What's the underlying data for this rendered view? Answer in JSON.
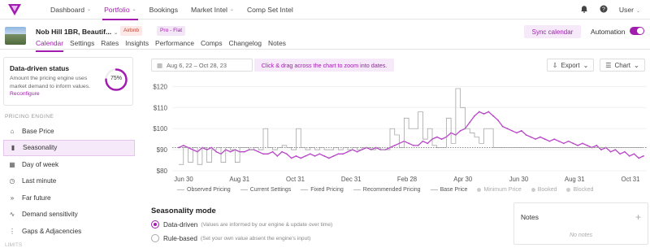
{
  "brand": {
    "accent": "#a21caf",
    "logo_icon": "wheelhouse-logo-icon"
  },
  "nav": [
    {
      "label": "Dashboard",
      "has_menu": true
    },
    {
      "label": "Portfolio",
      "has_menu": true,
      "active": true
    },
    {
      "label": "Bookings",
      "has_menu": false
    },
    {
      "label": "Market Intel",
      "has_menu": true
    },
    {
      "label": "Comp Set Intel",
      "has_menu": false
    }
  ],
  "topbar": {
    "user_label": "User",
    "bell_icon": "bell-icon",
    "help_icon": "help-icon"
  },
  "listing": {
    "title": "Nob Hill 1BR, Beautif...",
    "badge_channel": "Airbnb",
    "badge_plan": "Pro - Flat",
    "tabs": [
      "Calendar",
      "Settings",
      "Rates",
      "Insights",
      "Performance",
      "Comps",
      "Changelog",
      "Notes"
    ],
    "active_tab": "Calendar",
    "sync_label": "Sync calendar",
    "automation_label": "Automation",
    "automation_on": true
  },
  "status_card": {
    "title": "Data-driven status",
    "description": "Amount the pricing engine uses market demand to inform values.",
    "link": "Reconfigure",
    "percent_text": "75%",
    "percent": 0.75
  },
  "sidebar": {
    "section": "PRICING ENGINE",
    "items": [
      {
        "label": "Base Price",
        "icon": "tag-icon"
      },
      {
        "label": "Seasonality",
        "icon": "bar-chart-icon",
        "active": true
      },
      {
        "label": "Day of week",
        "icon": "calendar-icon"
      },
      {
        "label": "Last minute",
        "icon": "clock-icon"
      },
      {
        "label": "Far future",
        "icon": "forward-icon"
      },
      {
        "label": "Demand sensitivity",
        "icon": "wave-icon"
      },
      {
        "label": "Gaps & Adjacencies",
        "icon": "gaps-icon"
      }
    ],
    "next_section": "LIMITS"
  },
  "toolbar": {
    "date_range": "Aug 6, 22 – Oct 28, 23",
    "hint": "Click & drag across the chart to zoom into dates.",
    "export_label": "Export",
    "chart_label": "Chart"
  },
  "chart_data": {
    "type": "line",
    "x_ticks": [
      "Jun 30",
      "Aug 31",
      "Oct 31",
      "Dec 31",
      "Feb 28",
      "Apr 30",
      "Jun 30",
      "Aug 31",
      "Oct 31"
    ],
    "y_ticks": [
      "$120",
      "$110",
      "$100",
      "$90",
      "$80"
    ],
    "ylim": [
      80,
      124
    ],
    "base_price": 91,
    "series": [
      {
        "name": "Recommended Pricing",
        "color": "#b946c8",
        "values": [
          91,
          92,
          91,
          90,
          89,
          91,
          90,
          91,
          89,
          88,
          90,
          89,
          90,
          89,
          89,
          90,
          90,
          89,
          88,
          88,
          89,
          87,
          89,
          88,
          86,
          87,
          86,
          87,
          88,
          87,
          88,
          87,
          86,
          87,
          88,
          88,
          89,
          90,
          89,
          90,
          91,
          90,
          91,
          90,
          90,
          91,
          92,
          93,
          94,
          93,
          92,
          92,
          94,
          93,
          95,
          96,
          95,
          96,
          98,
          97,
          99,
          100,
          103,
          106,
          108,
          107,
          108,
          106,
          104,
          101,
          100,
          99,
          98,
          99,
          97,
          96,
          95,
          96,
          95,
          94,
          95,
          94,
          93,
          94,
          93,
          92,
          93,
          92,
          91,
          92,
          90,
          91,
          89,
          90,
          88,
          89,
          87,
          88,
          86,
          87
        ]
      },
      {
        "name": "Current Settings",
        "color": "#9a9a9a",
        "values": [
          83,
          91,
          84,
          91,
          83,
          91,
          84,
          90,
          91,
          84,
          91,
          90,
          84,
          91,
          91,
          90,
          91,
          90,
          100,
          91,
          90,
          91,
          92,
          91,
          90,
          100,
          91,
          90,
          91,
          90,
          91,
          90,
          90,
          91,
          90,
          91,
          90,
          91,
          90,
          91,
          91,
          90,
          91,
          90,
          90,
          100,
          97,
          91,
          105,
          100,
          100,
          108,
          95,
          100,
          92,
          91,
          91,
          105,
          93,
          119,
          110,
          100,
          98,
          96,
          93,
          100,
          100,
          91,
          91,
          91,
          91,
          91,
          91,
          91,
          91,
          91,
          91,
          91,
          91,
          91,
          91,
          91,
          91,
          91,
          91,
          91,
          91,
          91,
          91,
          91,
          91,
          91,
          91,
          91,
          91,
          91,
          91,
          91,
          91,
          91
        ]
      }
    ],
    "legend": [
      {
        "label": "Observed Pricing",
        "kind": "line"
      },
      {
        "label": "Current Settings",
        "kind": "line"
      },
      {
        "label": "Fixed Pricing",
        "kind": "line"
      },
      {
        "label": "Recommended Pricing",
        "kind": "line"
      },
      {
        "label": "Base Price",
        "kind": "line"
      },
      {
        "label": "Minimum Price",
        "kind": "dot",
        "muted": true
      },
      {
        "label": "Booked",
        "kind": "dot",
        "muted": true
      },
      {
        "label": "Blocked",
        "kind": "dot",
        "muted": true
      }
    ]
  },
  "seasonality": {
    "title": "Seasonality mode",
    "options": [
      {
        "label": "Data-driven",
        "desc": "(Values are informed by our engine & update over time)",
        "selected": true
      },
      {
        "label": "Rule-based",
        "desc": "(Set your own value absent the engine's input)",
        "selected": false
      }
    ]
  },
  "notes": {
    "title": "Notes",
    "empty": "No notes",
    "add_icon": "plus-icon"
  }
}
